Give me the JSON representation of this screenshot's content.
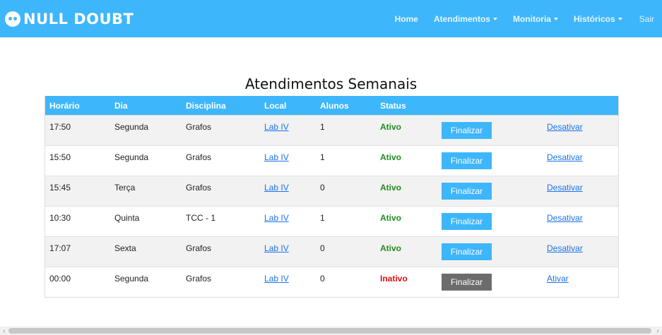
{
  "brand": {
    "name": "NULL DOUBT",
    "logo_icon": "owl-face-icon"
  },
  "nav": {
    "items": [
      {
        "label": "Home",
        "dropdown": false
      },
      {
        "label": "Atendimentos",
        "dropdown": true
      },
      {
        "label": "Monitoria",
        "dropdown": true
      },
      {
        "label": "Históricos",
        "dropdown": true
      },
      {
        "label": "Sair",
        "dropdown": false
      }
    ]
  },
  "page": {
    "title": "Atendimentos Semanais"
  },
  "table": {
    "headers": [
      "Horário",
      "Dia",
      "Disciplina",
      "Local",
      "Alunos",
      "Status"
    ],
    "rows": [
      {
        "horario": "17:50",
        "dia": "Segunda",
        "disciplina": "Grafos",
        "local": "Lab IV",
        "alunos": "1",
        "status": "Ativo",
        "status_color": "#1e8c1e",
        "button_label": "Finalizar",
        "button_color": "#3db6fb",
        "action": "Desativar"
      },
      {
        "horario": "15:50",
        "dia": "Segunda",
        "disciplina": "Grafos",
        "local": "Lab IV",
        "alunos": "1",
        "status": "Ativo",
        "status_color": "#1e8c1e",
        "button_label": "Finalizar",
        "button_color": "#3db6fb",
        "action": "Desativar"
      },
      {
        "horario": "15:45",
        "dia": "Terça",
        "disciplina": "Grafos",
        "local": "Lab IV",
        "alunos": "0",
        "status": "Ativo",
        "status_color": "#1e8c1e",
        "button_label": "Finalizar",
        "button_color": "#3db6fb",
        "action": "Desativar"
      },
      {
        "horario": "10:30",
        "dia": "Quinta",
        "disciplina": "TCC - 1",
        "local": "Lab IV",
        "alunos": "1",
        "status": "Ativo",
        "status_color": "#1e8c1e",
        "button_label": "Finalizar",
        "button_color": "#3db6fb",
        "action": "Desativar"
      },
      {
        "horario": "17:07",
        "dia": "Sexta",
        "disciplina": "Grafos",
        "local": "Lab IV",
        "alunos": "0",
        "status": "Ativo",
        "status_color": "#1e8c1e",
        "button_label": "Finalizar",
        "button_color": "#3db6fb",
        "action": "Desativar"
      },
      {
        "horario": "00:00",
        "dia": "Segunda",
        "disciplina": "Grafos",
        "local": "Lab IV",
        "alunos": "0",
        "status": "Inativo",
        "status_color": "#e01010",
        "button_label": "Finalizar",
        "button_color": "#6c6c6c",
        "action": "Ativar"
      }
    ]
  },
  "colors": {
    "accent": "#3db6fb",
    "active": "#1e8c1e",
    "inactive": "#e01010",
    "disabled_button": "#6c6c6c"
  }
}
